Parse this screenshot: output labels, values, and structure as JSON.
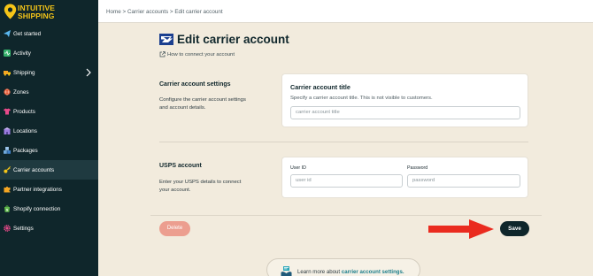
{
  "app": {
    "brand_line1": "INTUITIVE",
    "brand_line2": "SHIPPING"
  },
  "sidebar": {
    "items": [
      {
        "label": "Get started",
        "icon": "paper-plane-icon"
      },
      {
        "label": "Activity",
        "icon": "activity-icon"
      },
      {
        "label": "Shipping",
        "icon": "truck-icon"
      },
      {
        "label": "Zones",
        "icon": "globe-icon"
      },
      {
        "label": "Products",
        "icon": "shirt-icon"
      },
      {
        "label": "Locations",
        "icon": "building-icon"
      },
      {
        "label": "Packages",
        "icon": "boxes-icon"
      },
      {
        "label": "Carrier accounts",
        "icon": "key-icon"
      },
      {
        "label": "Partner integrations",
        "icon": "puzzle-icon"
      },
      {
        "label": "Shopify connection",
        "icon": "shopify-icon"
      },
      {
        "label": "Settings",
        "icon": "gear-icon"
      }
    ],
    "active": "Carrier accounts"
  },
  "breadcrumb": {
    "text": "Home > Carrier accounts > Edit carrier account"
  },
  "page": {
    "title": "Edit carrier account",
    "help_link": "How to connect your account"
  },
  "settings_section": {
    "title": "Carrier account settings",
    "desc_line1": "Configure the carrier account settings",
    "desc_line2": "and account details.",
    "card_title": "Carrier account title",
    "card_hint": "Specify a carrier account title. This is not visible to customers.",
    "title_placeholder": "carrier account title"
  },
  "usps_section": {
    "title": "USPS account",
    "desc_line1": "Enter your USPS details to connect",
    "desc_line2": "your account.",
    "userid_label": "User ID",
    "userid_placeholder": "user id",
    "password_label": "Password",
    "password_placeholder": "password"
  },
  "actions": {
    "delete_label": "Delete",
    "save_label": "Save"
  },
  "learn_more": {
    "prefix": "Learn more about ",
    "link": "carrier account settings."
  },
  "colors": {
    "sidebar": "#0f262b",
    "accent": "#f5c518",
    "save": "#0f262b",
    "delete": "#ec9e8f",
    "arrow": "#ea2b1f"
  }
}
